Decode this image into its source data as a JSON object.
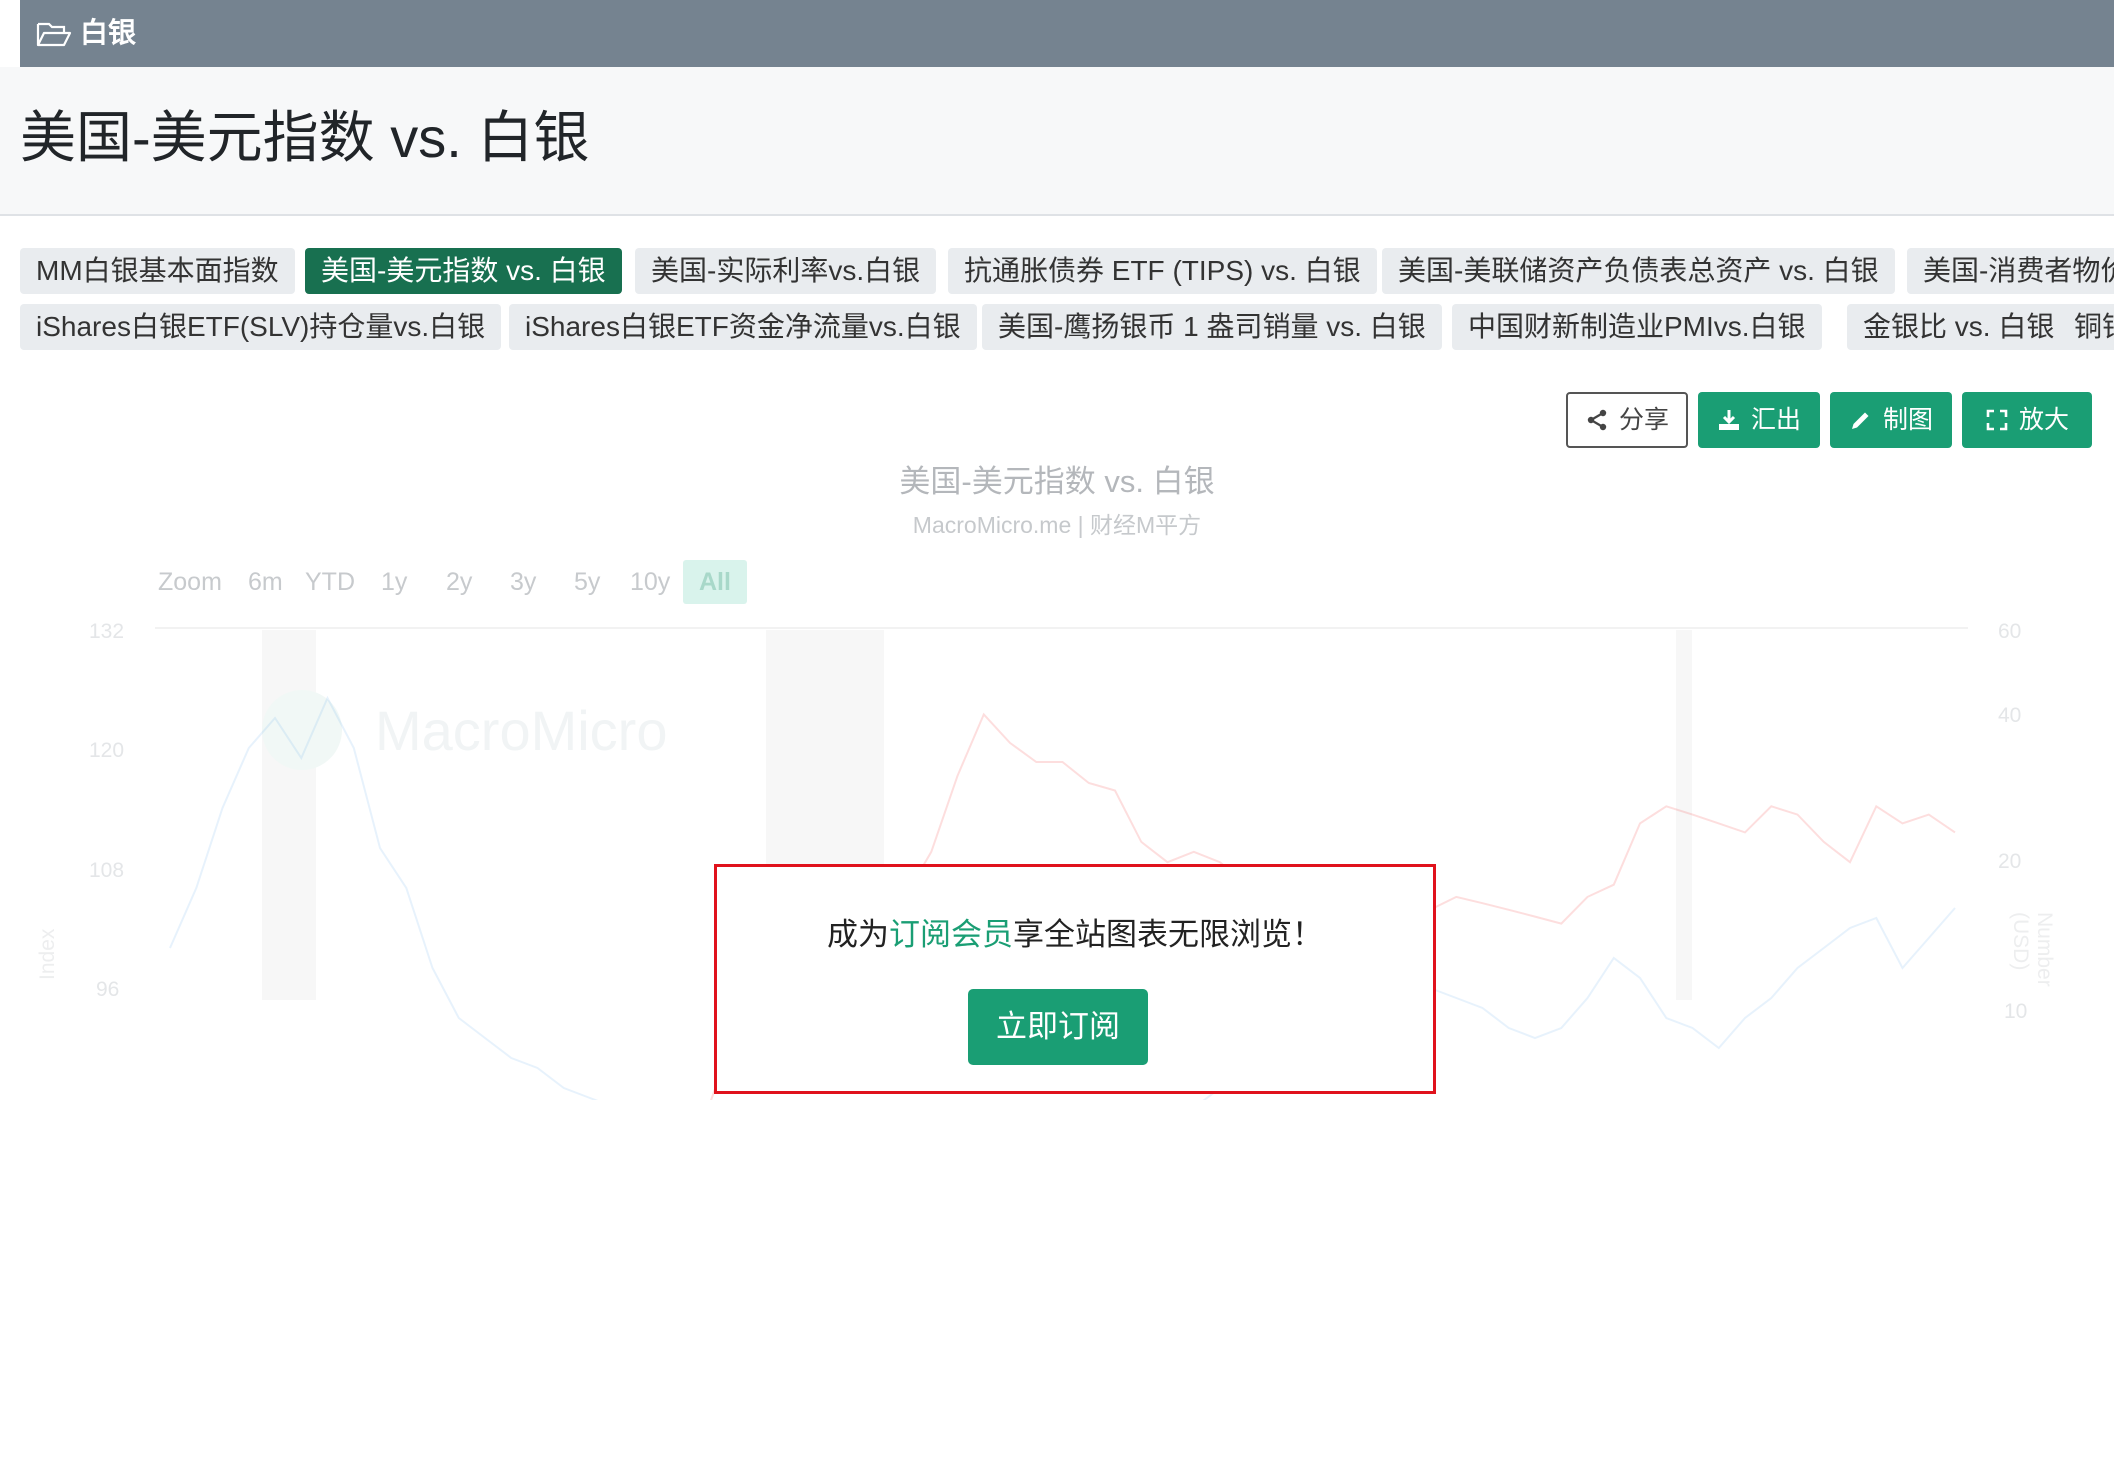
{
  "breadcrumb": {
    "label": "白银",
    "icon": "folder-icon"
  },
  "page": {
    "title": "美国-美元指数 vs. 白银"
  },
  "tabs_row1": [
    {
      "label": "MM白银基本面指数",
      "active": false
    },
    {
      "label": "美国-美元指数 vs. 白银",
      "active": true
    },
    {
      "label": "美国-实际利率vs.白银",
      "active": false
    },
    {
      "label": "抗通胀债券 ETF (TIPS) vs. 白银",
      "active": false
    },
    {
      "label": "美国-美联储资产负债表总资产 vs. 白银",
      "active": false
    },
    {
      "label": "美国-消费者物价",
      "active": false
    }
  ],
  "tabs_row2": [
    {
      "label": "iShares白银ETF(SLV)持仓量vs.白银"
    },
    {
      "label": "iShares白银ETF资金净流量vs.白银"
    },
    {
      "label": "美国-鹰扬银币 1 盎司销量 vs. 白银"
    },
    {
      "label": "中国财新制造业PMIvs.白银"
    },
    {
      "label": "金银比 vs. 白银"
    },
    {
      "label": "铜银"
    }
  ],
  "toolbar": {
    "share_label": "分享",
    "export_label": "汇出",
    "draw_label": "制图",
    "expand_label": "放大"
  },
  "chart": {
    "title": "美国-美元指数 vs. 白银",
    "credit": "MacroMicro.me | 财经M平方",
    "watermark": "MacroMicro",
    "zoom_buttons": [
      "Zoom",
      "6m",
      "YTD",
      "1y",
      "2y",
      "3y",
      "5y",
      "10y",
      "All"
    ],
    "zoom_selected": "All",
    "left_axis_label": "Index",
    "right_axis_label": "Number (USD)",
    "left_ticks": [
      "132",
      "120",
      "108",
      "96"
    ],
    "right_ticks": [
      "60",
      "40",
      "20",
      "10"
    ]
  },
  "chart_data": {
    "type": "line",
    "title": "美国-美元指数 vs. 白银",
    "ylabel": "Index",
    "y2label": "Number (USD)",
    "ylim": [
      96,
      132
    ],
    "y2_scale": "log",
    "y2_ticks": [
      10,
      20,
      40,
      60
    ],
    "series": [
      {
        "axis": "left",
        "color": "#7cb5ec",
        "values": [
          100,
          106,
          114,
          120,
          123,
          119,
          125,
          120,
          110,
          106,
          98,
          93,
          91,
          89,
          88,
          86,
          85,
          84,
          82,
          80,
          79,
          80,
          83,
          80,
          79,
          76,
          75,
          74,
          73,
          76,
          78,
          79,
          81,
          84,
          81,
          83,
          80,
          81,
          82,
          84,
          86,
          89,
          91,
          93,
          95,
          96,
          97,
          98,
          96,
          95,
          94,
          92,
          91,
          92,
          95,
          99,
          97,
          93,
          92,
          90,
          93,
          95,
          98,
          100,
          102,
          103,
          98,
          101,
          104
        ]
      },
      {
        "axis": "right",
        "color": "#f45b5b",
        "values": [
          5.5,
          5.2,
          5,
          5.2,
          5.5,
          6.5,
          5.8,
          5.5,
          5,
          4.8,
          4.7,
          5.2,
          5,
          4.7,
          4.9,
          4.8,
          5.3,
          5.2,
          5.1,
          5,
          5.3,
          7.5,
          9,
          12,
          10,
          9,
          12,
          15,
          17,
          21,
          30,
          40,
          35,
          32,
          32,
          29,
          28,
          22,
          20,
          21,
          20,
          18,
          17,
          15.5,
          17,
          17,
          16.5,
          15,
          16,
          17,
          16.5,
          16,
          15.5,
          15,
          17,
          18,
          24,
          26,
          25,
          24,
          23,
          26,
          25,
          22,
          20,
          26,
          24,
          25,
          23
        ]
      }
    ]
  },
  "overlay": {
    "text_before": "成为",
    "text_link": "订阅会员",
    "text_after": "享全站图表无限浏览！",
    "button_label": "立即订阅"
  }
}
